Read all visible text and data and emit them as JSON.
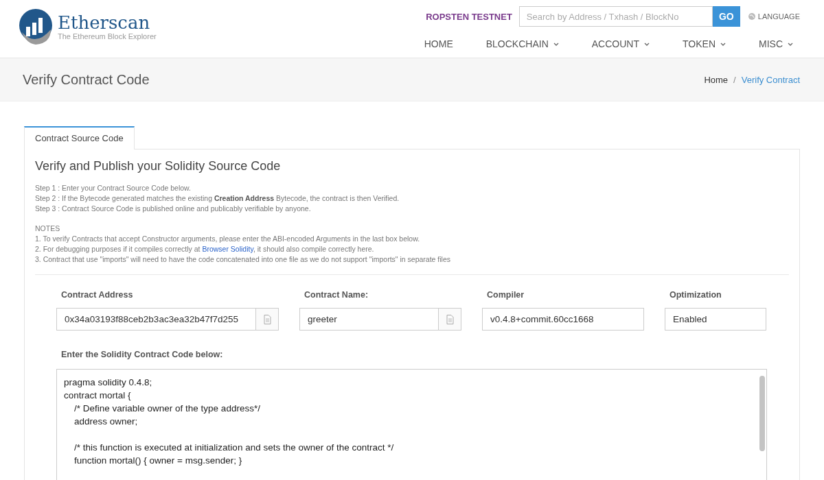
{
  "header": {
    "logo": {
      "name": "Etherscan",
      "tagline": "The Ethereum Block Explorer"
    },
    "network": "ROPSTEN TESTNET",
    "search": {
      "placeholder": "Search by Address / Txhash / BlockNo",
      "button": "GO"
    },
    "language": "LANGUAGE",
    "nav": [
      {
        "label": "HOME",
        "dropdown": false
      },
      {
        "label": "BLOCKCHAIN",
        "dropdown": true
      },
      {
        "label": "ACCOUNT",
        "dropdown": true
      },
      {
        "label": "TOKEN",
        "dropdown": true
      },
      {
        "label": "MISC",
        "dropdown": true
      }
    ]
  },
  "page_title": "Verify Contract Code",
  "breadcrumb_separator": "/",
  "breadcrumb": [
    {
      "label": "Home",
      "selected": false
    },
    {
      "label": "Verify Contract",
      "selected": true
    }
  ],
  "tabs": [
    {
      "label": "Contract Source Code",
      "selected": true
    }
  ],
  "heading": "Verify and Publish your Solidity Source Code",
  "steps": [
    "Step 1 : Enter your Contract Source Code below.",
    "Step 2 : If the Bytecode generated matches the existing **Creation Address** Bytecode, the contract is then Verified.",
    "Step 3 : Contract Source Code is published online and publicably verifiable by anyone."
  ],
  "notes_title": "NOTES",
  "notes": [
    {
      "before": "1. To verify Contracts that accept Constructor arguments, please enter the ABI-encoded Arguments in the last box below."
    },
    {
      "before": "2. For debugging purposes if it compiles correctly at ",
      "link": "Browser Solidity",
      "after": ", it should also compile correctly here."
    },
    {
      "before": "3. Contract that use \"imports\" will need to have the code concatenated into one file as we do not support \"imports\" in separate files"
    }
  ],
  "fields": [
    {
      "label": "Contract Address",
      "value": "0x34a03193f88ceb2b3ac3ea32b47f7d255",
      "addon": true
    },
    {
      "label": "Contract Name:",
      "value": "greeter",
      "addon": true
    },
    {
      "label": "Compiler",
      "value": "v0.4.8+commit.60cc1668",
      "addon": false
    },
    {
      "label": "Optimization",
      "value": "Enabled",
      "addon": false
    }
  ],
  "code_label": "Enter the Solidity Contract Code below:",
  "code": [
    [
      "pragma solidity 0.4.8;",
      "contract mortal {",
      "    /* Define variable owner of the type address*/",
      "    address owner;"
    ],
    [
      "    /* this function is executed at initialization and sets the owner of the contract */",
      "    function mortal() { owner = msg.sender; }"
    ]
  ]
}
